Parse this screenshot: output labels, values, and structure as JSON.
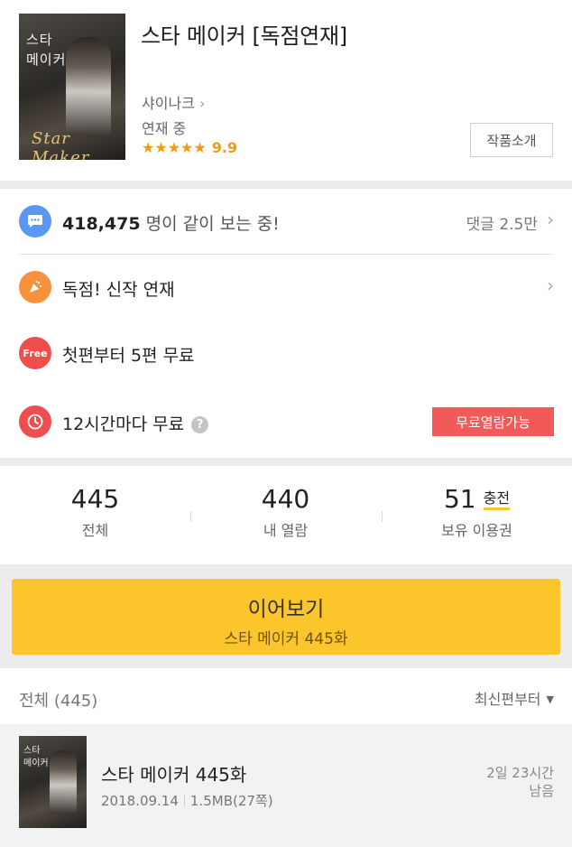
{
  "header": {
    "cover_title_lines": [
      "스타",
      "메이커"
    ],
    "cover_script": "Star Maker",
    "title": "스타 메이커 [독점연재]",
    "author": "샤이나크",
    "author_chevron": "›",
    "status": "연재 중",
    "stars": "★★★★★",
    "rating": "9.9",
    "intro_button": "작품소개"
  },
  "info_rows": {
    "viewers": {
      "icon": "chat-bubble-icon",
      "icon_color": "#5b97f2",
      "count": "418,475",
      "text": "명이 같이 보는 중!",
      "comments": "댓글 2.5만",
      "chevron": "›"
    },
    "exclusive": {
      "icon": "party-popper-icon",
      "icon_color": "#f8913c",
      "text": "독점! 신작 연재",
      "chevron": "›"
    },
    "free_first": {
      "icon": "free-icon",
      "icon_label": "Free",
      "icon_color": "#ef4e4e",
      "text": "첫편부터 5편 무료"
    },
    "free_12h": {
      "icon": "clock-icon",
      "icon_color": "#ef4e4e",
      "text": "12시간마다 무료",
      "help_icon": "?",
      "badge": "무료열람가능",
      "badge_color": "#f25a5a"
    }
  },
  "stats": {
    "total": {
      "value": "445",
      "label": "전체"
    },
    "read": {
      "value": "440",
      "label": "내 열람"
    },
    "tickets": {
      "value": "51",
      "charge": "충전",
      "label": "보유 이용권"
    }
  },
  "continue": {
    "label": "이어보기",
    "episode": "스타 메이커 445화",
    "color": "#fcc52c"
  },
  "list": {
    "header": "전체 (445)",
    "sort": "최신편부터",
    "sort_arrow": "▼",
    "items": [
      {
        "title": "스타 메이커 445화",
        "date": "2018.09.14",
        "size": "1.5MB(27쪽)",
        "remain_line1": "2일 23시간",
        "remain_line2": "남음"
      }
    ]
  }
}
